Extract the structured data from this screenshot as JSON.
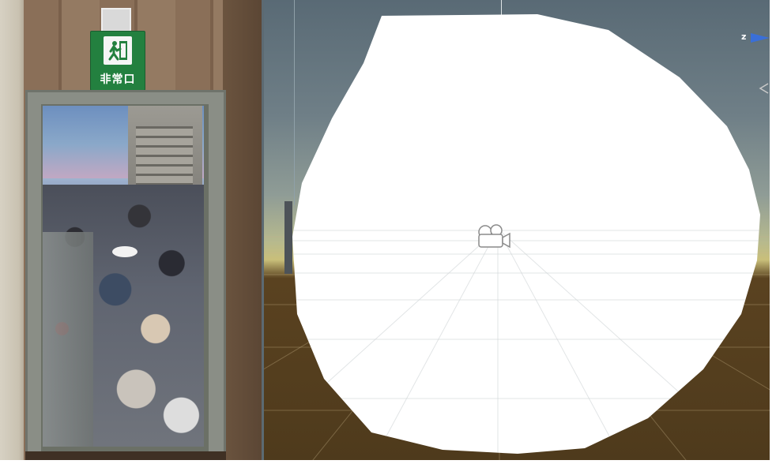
{
  "exit_sign": {
    "text": "非常口",
    "icon": "emergency-exit-icon",
    "color": "#23803f"
  },
  "scene_view": {
    "gizmo_axis_label": "z",
    "camera_icon": "camera-icon",
    "colors": {
      "sphere": "#ffffff",
      "axis_z": "#3a6fd8"
    }
  }
}
